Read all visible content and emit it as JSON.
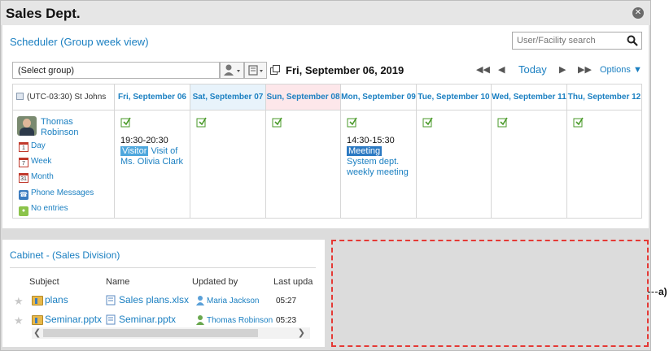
{
  "window": {
    "title": "Sales Dept."
  },
  "scheduler": {
    "title": "Scheduler (Group week view)",
    "search_placeholder": "User/Facility search",
    "group_select": "(Select group)",
    "current_date": "Fri, September 06, 2019",
    "today_label": "Today",
    "options_label": "Options",
    "timezone": "(UTC-03:30) St Johns",
    "days": [
      "Fri, September 06",
      "Sat, September 07",
      "Sun, September 08",
      "Mon, September 09",
      "Tue, September 10",
      "Wed, September 11",
      "Thu, September 12"
    ],
    "user": {
      "name": "Thomas Robinson",
      "links": {
        "day": "Day",
        "week": "Week",
        "month": "Month",
        "phone": "Phone Messages",
        "no_entries": "No entries"
      }
    },
    "events": {
      "fri": {
        "time": "19:30-20:30",
        "tag": "Visitor",
        "title": "Visit of Ms. Olivia Clark"
      },
      "mon": {
        "time": "14:30-15:30",
        "tag": "Meeting",
        "title": "System dept. weekly meeting"
      }
    }
  },
  "cabinet": {
    "title": "Cabinet - (Sales Division)",
    "columns": {
      "subject": "Subject",
      "name": "Name",
      "updated_by": "Updated by",
      "last_update": "Last upda"
    },
    "rows": [
      {
        "subject": "plans",
        "name": "Sales plans.xlsx",
        "updated_by": "Maria Jackson",
        "time": "05:27"
      },
      {
        "subject": "Seminar.pptx",
        "name": "Seminar.pptx",
        "updated_by": "Thomas Robinson",
        "time": "05:23"
      }
    ]
  },
  "annotation": {
    "label": "a)"
  },
  "colors": {
    "link": "#1a7fc1",
    "callout": "#e53935",
    "saturday_bg": "#e8f3fb",
    "sunday_bg": "#fde7ea"
  }
}
